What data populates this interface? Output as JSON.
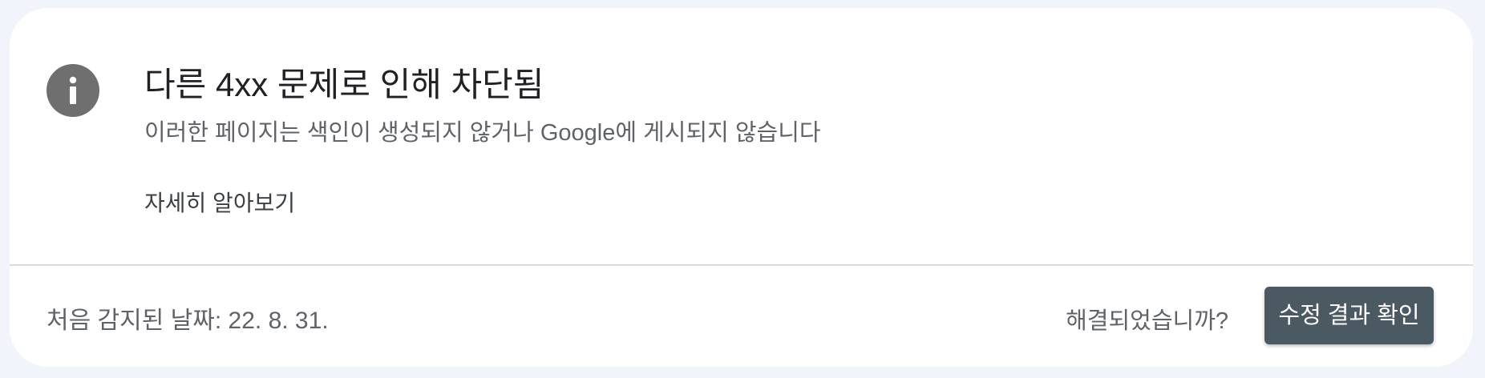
{
  "issue": {
    "icon": "info-icon",
    "title": "다른 4xx 문제로 인해 차단됨",
    "subtitle": "이러한 페이지는 색인이 생성되지 않거나 Google에 게시되지 않습니다",
    "learn_more_label": "자세히 알아보기"
  },
  "footer": {
    "first_detected_label": "처음 감지된 날짜: 22. 8. 31.",
    "resolved_question": "해결되었습니까?",
    "validate_button_label": "수정 결과 확인"
  },
  "colors": {
    "page_background": "#f1f4fb",
    "card_background": "#ffffff",
    "icon_background": "#6f6f6f",
    "button_background": "#4b5963",
    "divider": "#dadce0"
  }
}
